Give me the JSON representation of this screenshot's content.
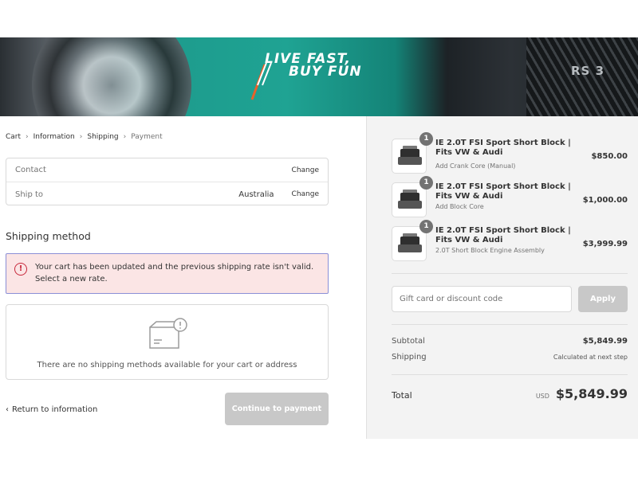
{
  "brand": {
    "line1": "LIVE FAST,",
    "line2": "BUY FUN",
    "car_badge": "RS 3"
  },
  "breadcrumb": [
    {
      "label": "Cart"
    },
    {
      "label": "Information"
    },
    {
      "label": "Shipping"
    },
    {
      "label": "Payment"
    }
  ],
  "review": {
    "contact_label": "Contact",
    "contact_value": "",
    "contact_change": "Change",
    "shipto_label": "Ship to",
    "shipto_value": "Australia",
    "shipto_change": "Change"
  },
  "shipping": {
    "title": "Shipping method",
    "alert": "Your cart has been updated and the previous shipping rate isn't valid. Select a new rate.",
    "empty_message": "There are no shipping methods available for your cart or address"
  },
  "nav": {
    "return_label": "Return to information",
    "continue_label": "Continue to payment"
  },
  "order": {
    "items": [
      {
        "qty": "1",
        "name": "IE 2.0T FSI Sport Short Block | Fits VW & Audi",
        "variant": "Add Crank Core (Manual)",
        "price": "$850.00"
      },
      {
        "qty": "1",
        "name": "IE 2.0T FSI Sport Short Block | Fits VW & Audi",
        "variant": "Add Block Core",
        "price": "$1,000.00"
      },
      {
        "qty": "1",
        "name": "IE 2.0T FSI Sport Short Block | Fits VW & Audi",
        "variant": "2.0T Short Block Engine Assembly",
        "price": "$3,999.99"
      }
    ],
    "discount_placeholder": "Gift card or discount code",
    "apply_label": "Apply",
    "subtotal_label": "Subtotal",
    "subtotal_value": "$5,849.99",
    "shipping_label": "Shipping",
    "shipping_value": "Calculated at next step",
    "total_label": "Total",
    "currency": "USD",
    "total_value": "$5,849.99"
  },
  "colors": {
    "accent_error": "#c7273b",
    "alert_bg": "#fbe5e5",
    "disabled_button": "#c8c8c8",
    "summary_bg": "#f3f3f3"
  }
}
